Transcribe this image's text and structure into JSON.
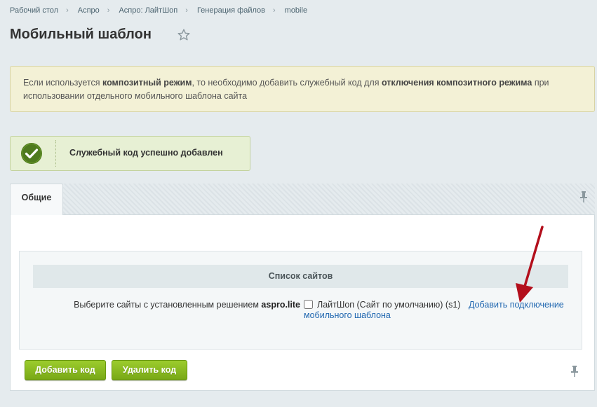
{
  "breadcrumb": {
    "items": [
      "Рабочий стол",
      "Аспро",
      "Аспро: ЛайтШоп",
      "Генерация файлов",
      "mobile"
    ]
  },
  "page": {
    "title": "Мобильный шаблон",
    "favorite_icon": "star-outline-icon"
  },
  "notice": {
    "part1": "Если используется ",
    "bold1": "композитный режим",
    "part2": ", то необходимо добавить служебный код для ",
    "bold2": "отключения композитного режима",
    "part3": " при использовании отдельного мобильного шаблона сайта"
  },
  "success": {
    "icon": "checkmark-circle-icon",
    "message": "Служебный код успешно добавлен"
  },
  "tabs": {
    "general": "Общие",
    "pin_icon": "pin-icon"
  },
  "sites": {
    "header": "Список сайтов",
    "label_prefix": "Выберите сайты с установленным решением ",
    "solution": "aspro.lite",
    "site_name": "ЛайтШоп (Сайт по умолчанию) (s1)",
    "link_line1": "Добавить подключение",
    "link_line2": "мобильного шаблона",
    "checked": false
  },
  "buttons": {
    "add": "Добавить код",
    "delete": "Удалить код"
  },
  "colors": {
    "button_green": "#8dbf21",
    "link_blue": "#2067b0",
    "success_bg": "#e7f0d4",
    "notice_bg": "#f3f1d6",
    "annotation_arrow": "#b30f1c"
  }
}
